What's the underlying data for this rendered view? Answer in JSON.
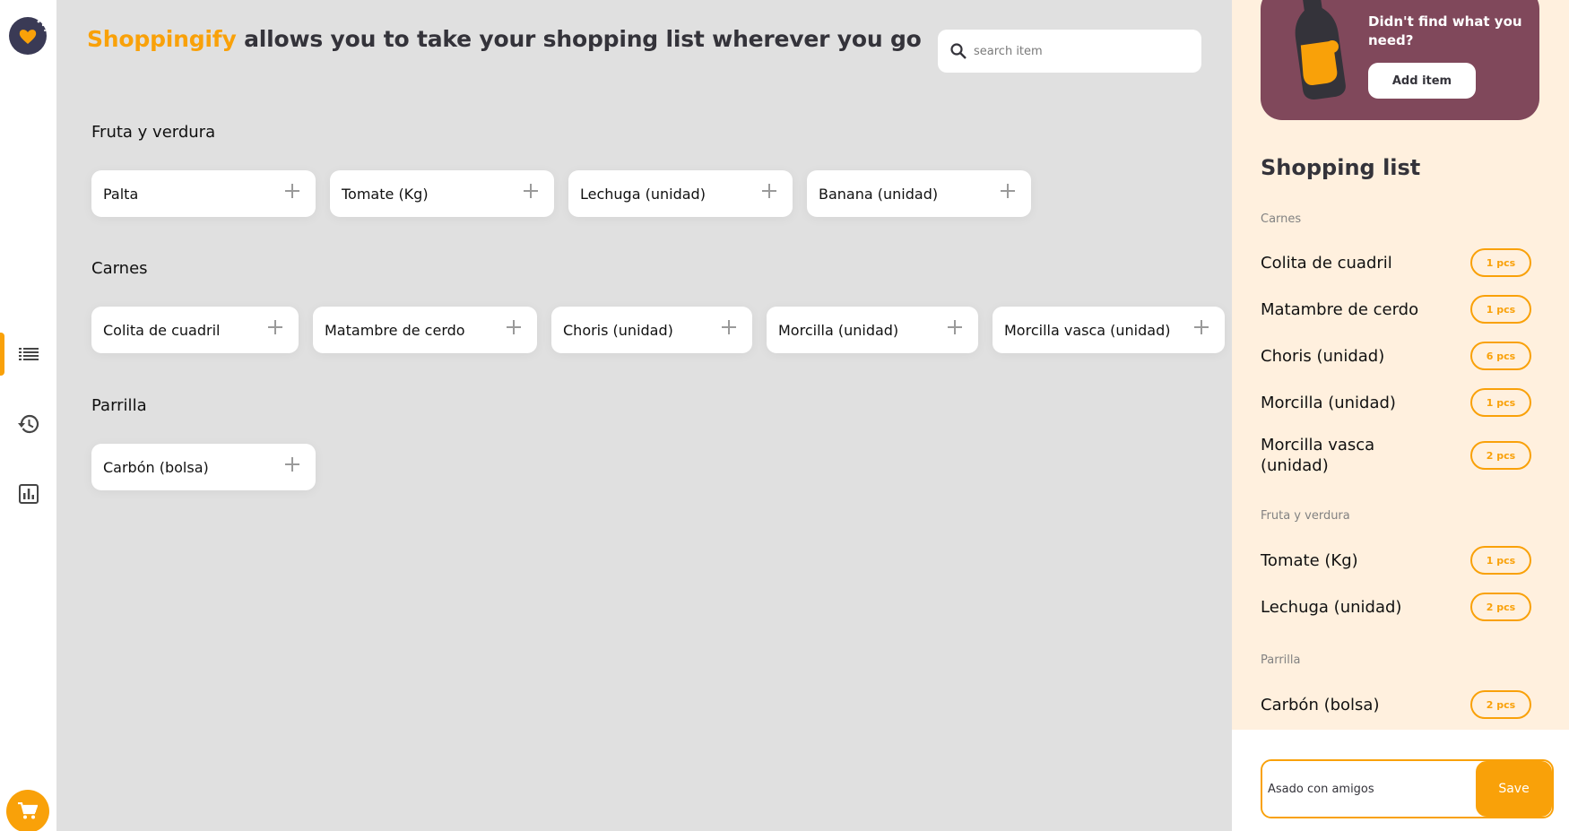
{
  "nav": {
    "logo_icon": "heart-logo-icon",
    "items": [
      {
        "name": "list",
        "icon": "list-icon",
        "active": true
      },
      {
        "name": "history",
        "icon": "history-icon",
        "active": false
      },
      {
        "name": "statistics",
        "icon": "bar-chart-icon",
        "active": false
      }
    ],
    "cart_icon": "shopping-cart-icon"
  },
  "header": {
    "brand": "Shoppingify",
    "tagline": " allows you to take your shopping list wherever you go"
  },
  "search": {
    "placeholder": "search item",
    "value": ""
  },
  "categories": [
    {
      "title": "Fruta y verdura",
      "items": [
        "Palta",
        "Tomate (Kg)",
        "Lechuga (unidad)",
        "Banana (unidad)"
      ]
    },
    {
      "title": "Carnes",
      "items": [
        "Colita de cuadril",
        "Matambre de cerdo",
        "Choris (unidad)",
        "Morcilla (unidad)",
        "Morcilla vasca (unidad)"
      ]
    },
    {
      "title": "Parrilla",
      "items": [
        "Carbón (bolsa)"
      ]
    }
  ],
  "promo": {
    "text": "Didn't find what you need?",
    "button": "Add item"
  },
  "shopping_list": {
    "title": "Shopping list",
    "groups": [
      {
        "title": "Carnes",
        "items": [
          {
            "name": "Colita de cuadril",
            "qty": "1 pcs"
          },
          {
            "name": "Matambre de cerdo",
            "qty": "1 pcs"
          },
          {
            "name": "Choris (unidad)",
            "qty": "6 pcs"
          },
          {
            "name": "Morcilla (unidad)",
            "qty": "1 pcs"
          },
          {
            "name": "Morcilla vasca (unidad)",
            "qty": "2 pcs"
          }
        ]
      },
      {
        "title": "Fruta y verdura",
        "items": [
          {
            "name": "Tomate (Kg)",
            "qty": "1 pcs"
          },
          {
            "name": "Lechuga (unidad)",
            "qty": "2 pcs"
          }
        ]
      },
      {
        "title": "Parrilla",
        "items": [
          {
            "name": "Carbón (bolsa)",
            "qty": "2 pcs"
          }
        ]
      }
    ]
  },
  "save": {
    "list_name": "Asado con amigos",
    "button": "Save"
  },
  "colors": {
    "accent": "#f9a109",
    "promo_bg": "#80485b",
    "panel_bg": "#fff0de",
    "main_bg": "#e0e0e0"
  }
}
